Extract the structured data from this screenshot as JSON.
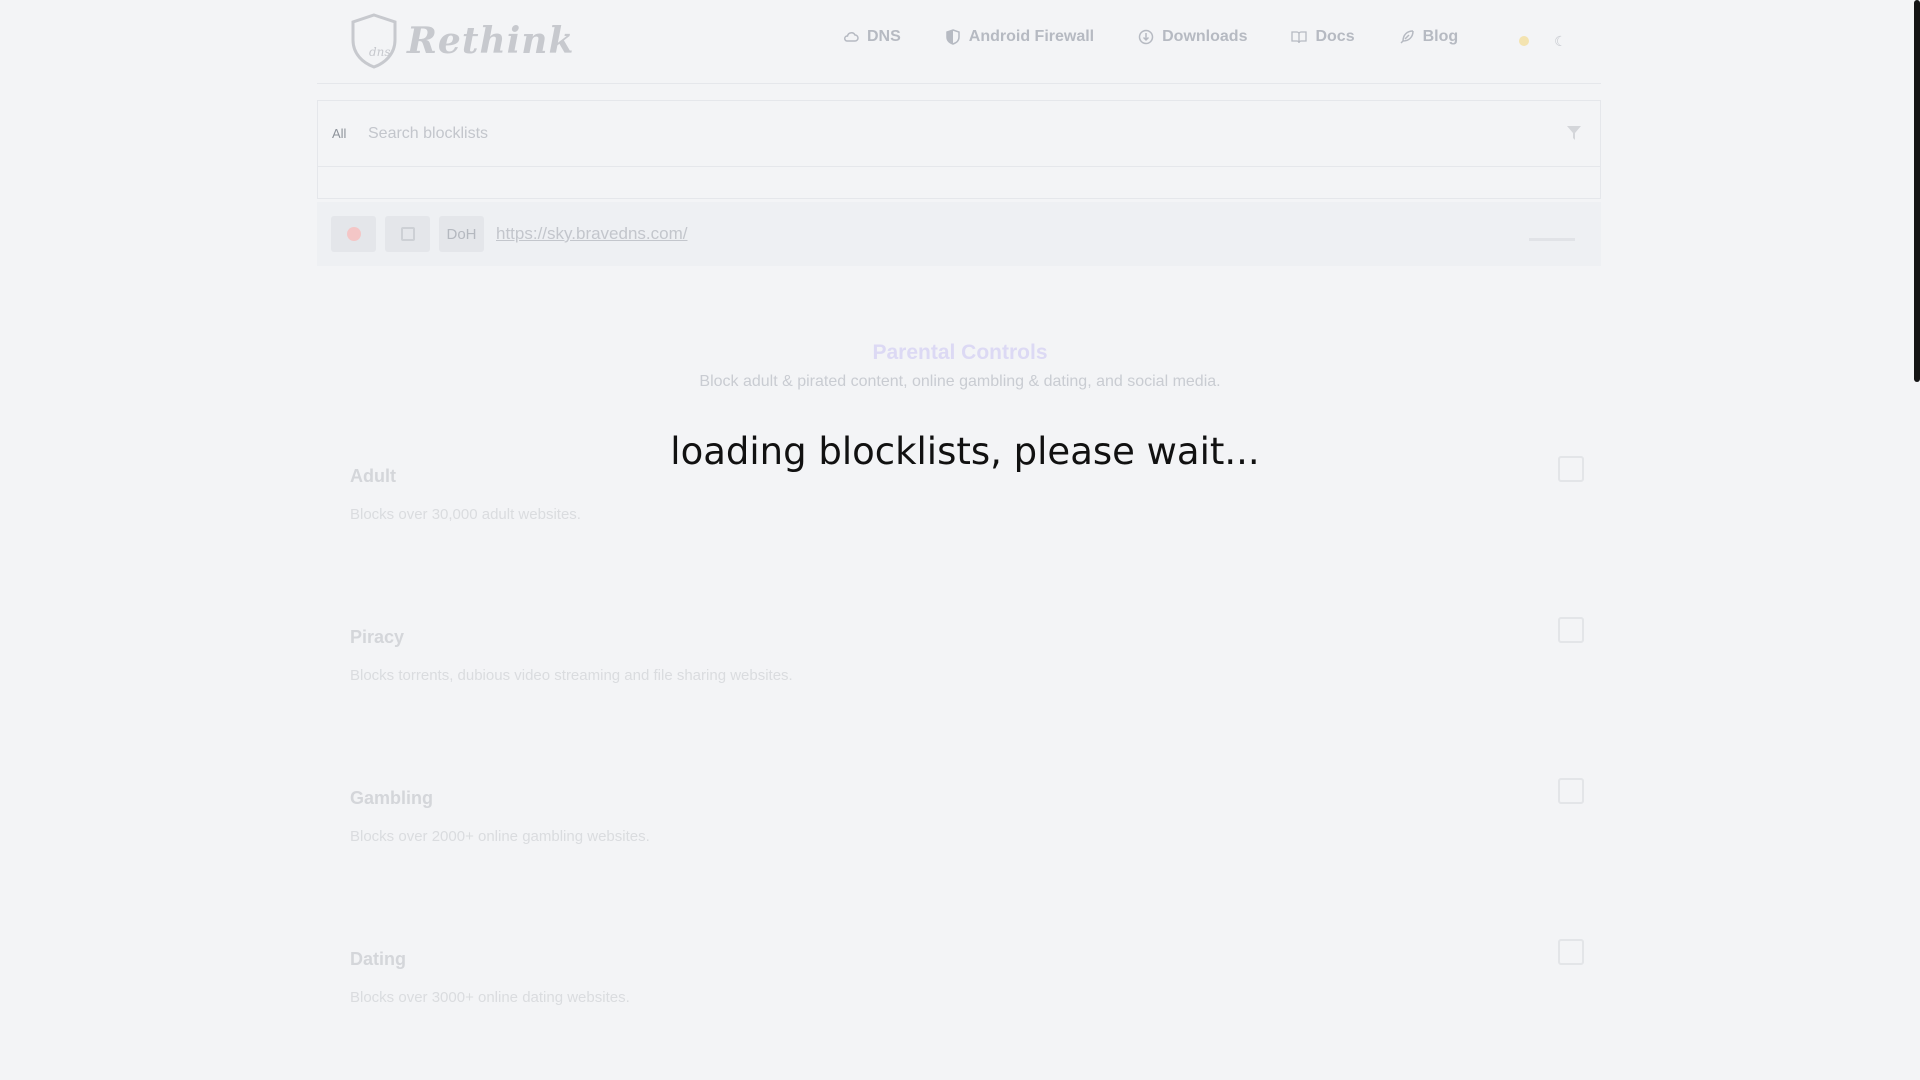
{
  "header": {
    "logo_text": "Rethink",
    "logo_badge": "dns",
    "nav": [
      {
        "label": "DNS",
        "icon": "cloud-icon"
      },
      {
        "label": "Android Firewall",
        "icon": "shield-half-icon"
      },
      {
        "label": "Downloads",
        "icon": "download-circle-icon"
      },
      {
        "label": "Docs",
        "icon": "book-icon"
      },
      {
        "label": "Blog",
        "icon": "feather-icon"
      }
    ]
  },
  "search": {
    "scope_label": "All",
    "placeholder": "Search blocklists"
  },
  "endpoint": {
    "protocol_label": "DoH",
    "url": "https://sky.bravedns.com/"
  },
  "section": {
    "title": "Parental Controls",
    "subtitle": "Block adult & pirated content, online gambling & dating, and social media."
  },
  "blocklists": [
    {
      "title": "Adult",
      "description": "Blocks over 30,000 adult websites."
    },
    {
      "title": "Piracy",
      "description": "Blocks torrents, dubious video streaming and file sharing websites."
    },
    {
      "title": "Gambling",
      "description": "Blocks over 2000+ online gambling websites."
    },
    {
      "title": "Dating",
      "description": "Blocks over 3000+ online dating websites."
    }
  ],
  "loading_message": "loading blocklists, please wait...",
  "colors": {
    "background": "#f3f4f6",
    "accent_title": "#dcd9f4",
    "scrollbar": "#141414"
  }
}
